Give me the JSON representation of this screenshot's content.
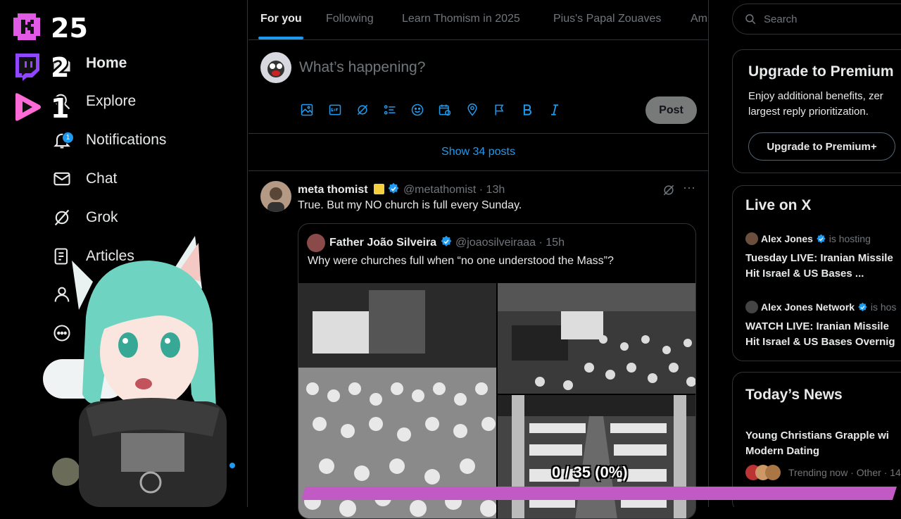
{
  "overlay": {
    "counters": [
      {
        "icon": "kick-icon",
        "value": "25"
      },
      {
        "icon": "twitch-icon",
        "value": "2"
      },
      {
        "icon": "play-icon",
        "value": "1"
      }
    ],
    "progress_text": "0 / 35 (0%)",
    "progress_fraction": 0,
    "colors": {
      "kick": "#e15ae5",
      "twitch": "#9146ff",
      "play": "#ff6bd6",
      "bar": "#c25ac6"
    }
  },
  "nav": {
    "items": [
      {
        "label": "Home",
        "icon": "home-icon"
      },
      {
        "label": "Explore",
        "icon": "search-icon"
      },
      {
        "label": "Notifications",
        "icon": "bell-icon",
        "badge": "1"
      },
      {
        "label": "Chat",
        "icon": "mail-icon"
      },
      {
        "label": "Grok",
        "icon": "grok-icon"
      },
      {
        "label": "Articles",
        "icon": "articles-icon"
      }
    ]
  },
  "tabs": [
    "For you",
    "Following",
    "Learn Thomism in 2025",
    "Pius's Papal Zouaves",
    "Am"
  ],
  "composer": {
    "placeholder": "What’s happening?",
    "post_label": "Post"
  },
  "show_posts": "Show 34 posts",
  "tweet": {
    "name": "meta thomist",
    "handle": "@metathomist",
    "time": "· 13h",
    "text": "True. But my NO church is full every Sunday.",
    "quote": {
      "name": "Father João Silveira",
      "handle": "@joaosilveiraaa",
      "time": "· 15h",
      "text": "Why were churches full when “no one understood the Mass”?"
    }
  },
  "right": {
    "search_placeholder": "Search",
    "premium": {
      "title": "Upgrade to Premium",
      "line1": "Enjoy additional benefits, zer",
      "line2": "largest reply prioritization.",
      "button": "Upgrade to Premium+"
    },
    "live": {
      "title": "Live on X",
      "items": [
        {
          "host": "Alex Jones",
          "suffix": "is hosting",
          "line1": "Tuesday LIVE: Iranian Missile",
          "line2": "Hit Israel & US Bases ..."
        },
        {
          "host": "Alex Jones Network",
          "suffix": "is hos",
          "line1": "WATCH LIVE: Iranian Missile",
          "line2": "Hit Israel & US Bases Overnig"
        }
      ]
    },
    "news": {
      "title": "Today’s News",
      "headline1": "Young Christians Grapple wi",
      "headline2": "Modern Dating",
      "meta": "Trending now · Other · 14"
    }
  }
}
